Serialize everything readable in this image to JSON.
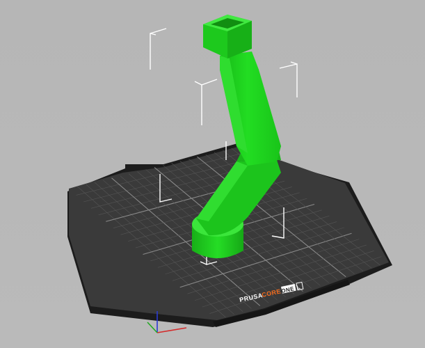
{
  "viewport": {
    "background": "#b7b7b7"
  },
  "bed": {
    "brand": {
      "prusa": "PRUSA",
      "core": "CORE",
      "one": "ONE",
      "l": "L"
    },
    "colors": {
      "surface": "#3a3a3a",
      "edge": "#1e1e1e",
      "grid_major": "#8a8a8a",
      "grid_minor": "#555555",
      "brand_accent": "#f26b1d"
    }
  },
  "model": {
    "color": "#1fd11f",
    "color_dark": "#14a814",
    "color_light": "#55ee4a"
  },
  "axes": {
    "x_color": "#d42a2a",
    "y_color": "#22aa22",
    "z_color": "#2a3ad4"
  }
}
